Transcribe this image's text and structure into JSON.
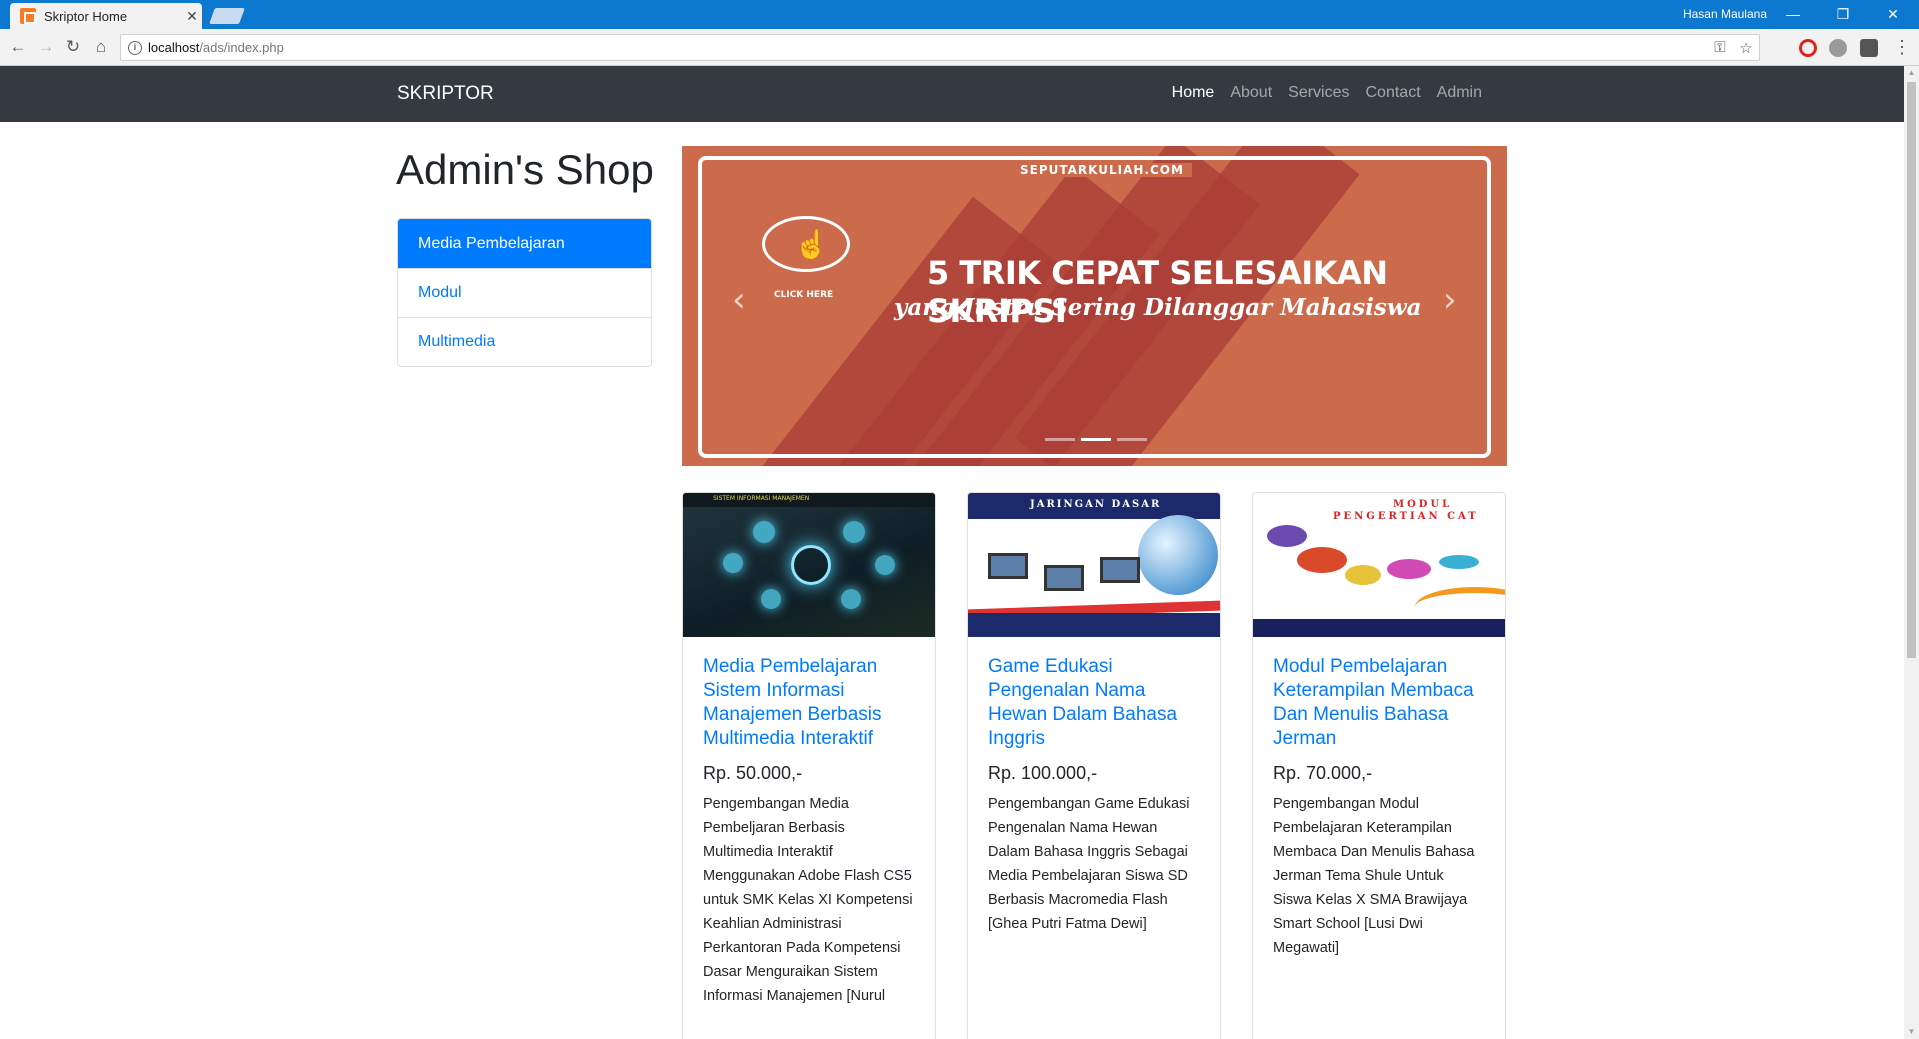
{
  "browser": {
    "tab_title": "Skriptor Home",
    "tab_close": "✕",
    "user_name": "Hasan Maulana",
    "url_host": "localhost",
    "url_path": "/ads/index.php",
    "minimize": "—",
    "restore": "❐",
    "close": "✕"
  },
  "navbar": {
    "brand": "SKRIPTOR",
    "links": [
      "Home",
      "About",
      "Services",
      "Contact",
      "Admin"
    ]
  },
  "page": {
    "title": "Admin's Shop",
    "categories": [
      "Media Pembelajaran",
      "Modul",
      "Multimedia"
    ]
  },
  "carousel": {
    "site_label": "SEPUTARKULIAH.COM",
    "click_label": "CLICK HERE",
    "headline": "5 TRIK CEPAT SELESAIKAN SKRIPSI",
    "subheadline": "yang Justru Sering Dilanggar Mahasiswa",
    "prev": "‹",
    "next": "›",
    "indicator_count": 3,
    "active_indicator": 2
  },
  "products": [
    {
      "title": "Media Pembelajaran Sistem Informasi Manajemen Berbasis Multimedia Interaktif",
      "price": "Rp. 50.000,-",
      "description": "Pengembangan Media Pembeljaran Berbasis Multimedia Interaktif Menggunakan Adobe Flash CS5 untuk SMK Kelas XI Kompetensi Keahlian Administrasi Perkantoran Pada Kompetensi Dasar Menguraikan Sistem Informasi Manajemen [Nurul",
      "image_label": "SISTEM INFORMASI MANAJEMEN"
    },
    {
      "title": "Game Edukasi Pengenalan Nama Hewan Dalam Bahasa Inggris",
      "price": "Rp. 100.000,-",
      "description": "Pengembangan Game Edukasi Pengenalan Nama Hewan Dalam Bahasa Inggris Sebagai Media Pembelajaran Siswa SD Berbasis Macromedia Flash [Ghea Putri Fatma Dewi]",
      "image_label": "JARINGAN DASAR"
    },
    {
      "title": "Modul Pembelajaran Keterampilan Membaca Dan Menulis Bahasa Jerman",
      "price": "Rp. 70.000,-",
      "description": "Pengembangan Modul Pembelajaran Keterampilan Membaca Dan Menulis Bahasa Jerman Tema Shule Untuk Siswa Kelas X SMA Brawijaya Smart School [Lusi Dwi Megawati]",
      "image_label_1": "MODUL",
      "image_label_2": "PENGERTIAN CAT"
    }
  ],
  "colors": {
    "navbar_bg": "#343a40",
    "primary": "#007bff",
    "carousel_bg": "#cc6b4c",
    "titlebar": "#0d78d0"
  }
}
